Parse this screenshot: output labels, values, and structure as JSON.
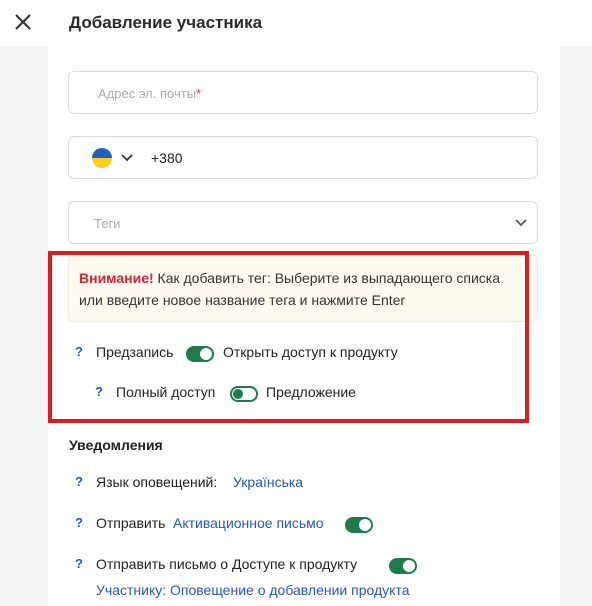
{
  "header": {
    "title": "Добавление участника"
  },
  "form": {
    "email_placeholder": "Адрес эл. почты",
    "required_mark": "*",
    "phone_code": "+380",
    "country_flag": "ukraine-flag",
    "tags_placeholder": "Теги"
  },
  "notice": {
    "strong": "Внимание!",
    "text": " Как добавить тег: Выберите из выпадающего списка или введите новое название тега и нажмите Enter"
  },
  "access": {
    "q_mark": "?",
    "preregister_label": "Предзапись",
    "preregister_toggle": "on",
    "open_access_label": "Открыть доступ к продукту",
    "full_access_label": "Полный доступ",
    "full_access_toggle": "off",
    "offer_label": "Предложение"
  },
  "notifications": {
    "title": "Уведомления",
    "language_label": "Язык оповещений:",
    "language_value": "Українська",
    "send_label": "Отправить",
    "activation_link": "Активационное письмо",
    "activation_toggle": "on",
    "access_letter_label": "Отправить письмо о Доступе к продукту",
    "access_letter_toggle": "on",
    "participant_link": "Участнику: Оповещение о добавлении продукта"
  },
  "colors": {
    "accent": "#1f7a4d",
    "link": "#2356c6",
    "alert": "#d9232f",
    "frame": "#e01b1b"
  }
}
